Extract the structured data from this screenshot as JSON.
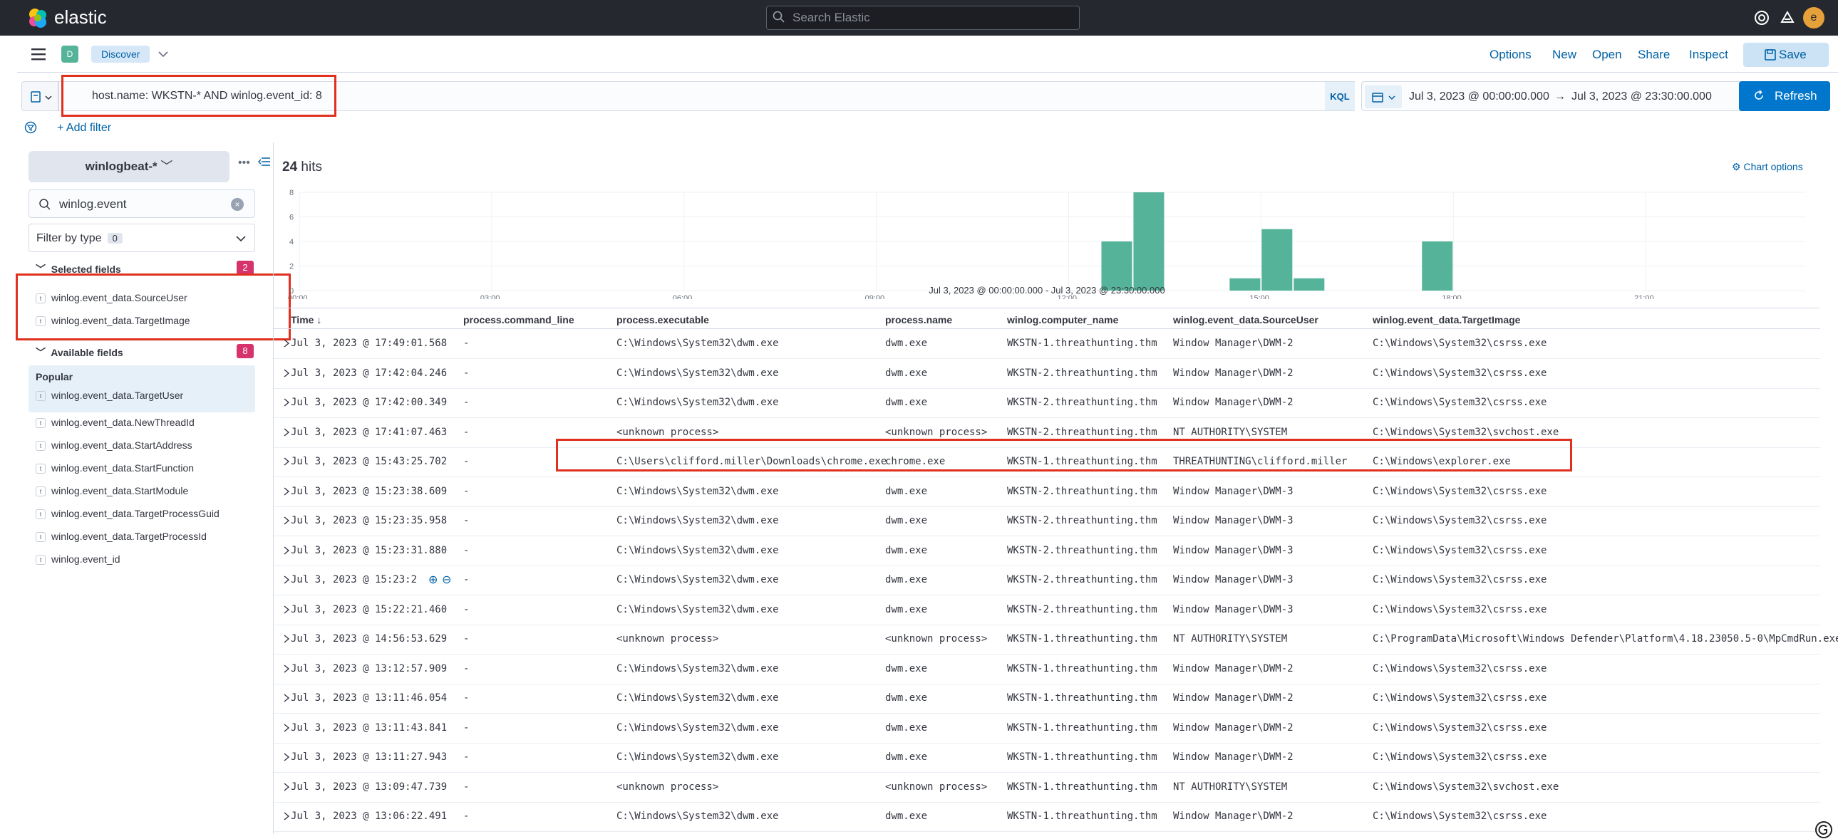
{
  "app": {
    "brand": "elastic",
    "search_placeholder": "Search Elastic",
    "avatar_letter": "e"
  },
  "nav": {
    "badge": "D",
    "breadcrumb": "Discover",
    "menu": [
      "Options",
      "New",
      "Open",
      "Share",
      "Inspect"
    ],
    "save_label": "Save"
  },
  "query": {
    "text": "host.name: WKSTN-* AND winlog.event_id: 8",
    "language": "KQL",
    "time_start": "Jul 3, 2023 @ 00:00:00.000",
    "time_arrow": "→",
    "time_end": "Jul 3, 2023 @ 23:30:00.000",
    "refresh_label": "Refresh",
    "add_filter_label": "+ Add filter"
  },
  "sidebar": {
    "index_pattern": "winlogbeat-*",
    "more_glyph": "•••",
    "field_search_value": "winlog.event",
    "filter_by_type": "Filter by type",
    "filter_type_count": "0",
    "selected_heading": "Selected fields",
    "selected_count": "2",
    "selected_fields": [
      "winlog.event_data.SourceUser",
      "winlog.event_data.TargetImage"
    ],
    "available_heading": "Available fields",
    "available_count": "8",
    "popular_heading": "Popular",
    "popular_fields": [
      "winlog.event_data.TargetUser"
    ],
    "available_fields": [
      "winlog.event_data.NewThreadId",
      "winlog.event_data.StartAddress",
      "winlog.event_data.StartFunction",
      "winlog.event_data.StartModule",
      "winlog.event_data.TargetProcessGuid",
      "winlog.event_data.TargetProcessId",
      "winlog.event_id"
    ],
    "field_type_token": "t"
  },
  "results": {
    "hits_count": "24",
    "hits_label": "hits",
    "chart_options_label": "Chart options",
    "range_label": "Jul 3, 2023 @ 00:00:00.000 - Jul 3, 2023 @ 23:30:00.000"
  },
  "chart_data": {
    "type": "bar",
    "y_ticks": [
      "0",
      "2",
      "4",
      "6",
      "8"
    ],
    "ylim": [
      0,
      8
    ],
    "x_ticks": [
      "00:00",
      "03:00",
      "06:00",
      "09:00",
      "12:00",
      "15:00",
      "18:00",
      "21:00"
    ],
    "x_tick_hours": [
      0,
      3,
      6,
      9,
      12,
      15,
      18,
      21
    ],
    "xlim_hours": [
      0,
      23.5
    ],
    "bar_width_hours": 0.5,
    "bars": [
      {
        "hour": 12.5,
        "value": 4
      },
      {
        "hour": 13.0,
        "value": 8
      },
      {
        "hour": 14.5,
        "value": 1
      },
      {
        "hour": 15.0,
        "value": 5
      },
      {
        "hour": 15.5,
        "value": 1
      },
      {
        "hour": 17.5,
        "value": 4
      }
    ],
    "bar_color": "#54b399"
  },
  "table": {
    "columns": [
      "Time ↓",
      "process.command_line",
      "process.executable",
      "process.name",
      "winlog.computer_name",
      "winlog.event_data.SourceUser",
      "winlog.event_data.TargetImage"
    ],
    "rows": [
      [
        "Jul 3, 2023 @ 17:49:01.568",
        "-",
        "C:\\Windows\\System32\\dwm.exe",
        "dwm.exe",
        "WKSTN-1.threathunting.thm",
        "Window Manager\\DWM-2",
        "C:\\Windows\\System32\\csrss.exe"
      ],
      [
        "Jul 3, 2023 @ 17:42:04.246",
        "-",
        "C:\\Windows\\System32\\dwm.exe",
        "dwm.exe",
        "WKSTN-2.threathunting.thm",
        "Window Manager\\DWM-2",
        "C:\\Windows\\System32\\csrss.exe"
      ],
      [
        "Jul 3, 2023 @ 17:42:00.349",
        "-",
        "C:\\Windows\\System32\\dwm.exe",
        "dwm.exe",
        "WKSTN-2.threathunting.thm",
        "Window Manager\\DWM-2",
        "C:\\Windows\\System32\\csrss.exe"
      ],
      [
        "Jul 3, 2023 @ 17:41:07.463",
        "-",
        "<unknown process>",
        "<unknown process>",
        "WKSTN-2.threathunting.thm",
        "NT AUTHORITY\\SYSTEM",
        "C:\\Windows\\System32\\svchost.exe"
      ],
      [
        "Jul 3, 2023 @ 15:43:25.702",
        "-",
        "C:\\Users\\clifford.miller\\Downloads\\chrome.exe",
        "chrome.exe",
        "WKSTN-1.threathunting.thm",
        "THREATHUNTING\\clifford.miller",
        "C:\\Windows\\explorer.exe"
      ],
      [
        "Jul 3, 2023 @ 15:23:38.609",
        "-",
        "C:\\Windows\\System32\\dwm.exe",
        "dwm.exe",
        "WKSTN-2.threathunting.thm",
        "Window Manager\\DWM-3",
        "C:\\Windows\\System32\\csrss.exe"
      ],
      [
        "Jul 3, 2023 @ 15:23:35.958",
        "-",
        "C:\\Windows\\System32\\dwm.exe",
        "dwm.exe",
        "WKSTN-2.threathunting.thm",
        "Window Manager\\DWM-3",
        "C:\\Windows\\System32\\csrss.exe"
      ],
      [
        "Jul 3, 2023 @ 15:23:31.880",
        "-",
        "C:\\Windows\\System32\\dwm.exe",
        "dwm.exe",
        "WKSTN-2.threathunting.thm",
        "Window Manager\\DWM-3",
        "C:\\Windows\\System32\\csrss.exe"
      ],
      [
        "Jul 3, 2023 @ 15:23:2",
        "-",
        "C:\\Windows\\System32\\dwm.exe",
        "dwm.exe",
        "WKSTN-2.threathunting.thm",
        "Window Manager\\DWM-3",
        "C:\\Windows\\System32\\csrss.exe"
      ],
      [
        "Jul 3, 2023 @ 15:22:21.460",
        "-",
        "C:\\Windows\\System32\\dwm.exe",
        "dwm.exe",
        "WKSTN-2.threathunting.thm",
        "Window Manager\\DWM-3",
        "C:\\Windows\\System32\\csrss.exe"
      ],
      [
        "Jul 3, 2023 @ 14:56:53.629",
        "-",
        "<unknown process>",
        "<unknown process>",
        "WKSTN-1.threathunting.thm",
        "NT AUTHORITY\\SYSTEM",
        "C:\\ProgramData\\Microsoft\\Windows Defender\\Platform\\4.18.23050.5-0\\MpCmdRun.exe"
      ],
      [
        "Jul 3, 2023 @ 13:12:57.909",
        "-",
        "C:\\Windows\\System32\\dwm.exe",
        "dwm.exe",
        "WKSTN-1.threathunting.thm",
        "Window Manager\\DWM-2",
        "C:\\Windows\\System32\\csrss.exe"
      ],
      [
        "Jul 3, 2023 @ 13:11:46.054",
        "-",
        "C:\\Windows\\System32\\dwm.exe",
        "dwm.exe",
        "WKSTN-1.threathunting.thm",
        "Window Manager\\DWM-2",
        "C:\\Windows\\System32\\csrss.exe"
      ],
      [
        "Jul 3, 2023 @ 13:11:43.841",
        "-",
        "C:\\Windows\\System32\\dwm.exe",
        "dwm.exe",
        "WKSTN-1.threathunting.thm",
        "Window Manager\\DWM-2",
        "C:\\Windows\\System32\\csrss.exe"
      ],
      [
        "Jul 3, 2023 @ 13:11:27.943",
        "-",
        "C:\\Windows\\System32\\dwm.exe",
        "dwm.exe",
        "WKSTN-1.threathunting.thm",
        "Window Manager\\DWM-2",
        "C:\\Windows\\System32\\csrss.exe"
      ],
      [
        "Jul 3, 2023 @ 13:09:47.739",
        "-",
        "<unknown process>",
        "<unknown process>",
        "WKSTN-1.threathunting.thm",
        "NT AUTHORITY\\SYSTEM",
        "C:\\Windows\\System32\\svchost.exe"
      ],
      [
        "Jul 3, 2023 @ 13:06:22.491",
        "-",
        "C:\\Windows\\System32\\dwm.exe",
        "dwm.exe",
        "WKSTN-1.threathunting.thm",
        "Window Manager\\DWM-2",
        "C:\\Windows\\System32\\csrss.exe"
      ]
    ]
  },
  "colors": {
    "accent": "#0077cc",
    "link": "#0061a6",
    "highlight": "#e0301e",
    "badge": "#d6336c",
    "bar": "#54b399"
  },
  "icons": [
    "elastic-logo-icon",
    "search-icon",
    "help-icon",
    "newsfeed-icon",
    "menu-icon",
    "chevron-down-icon",
    "save-icon",
    "calendar-icon",
    "refresh-icon",
    "filter-icon",
    "more-icon",
    "collapse-icon",
    "clear-icon",
    "gear-icon",
    "chevron-right-icon",
    "plus-circle-icon",
    "minus-circle-icon",
    "gen-icon"
  ]
}
